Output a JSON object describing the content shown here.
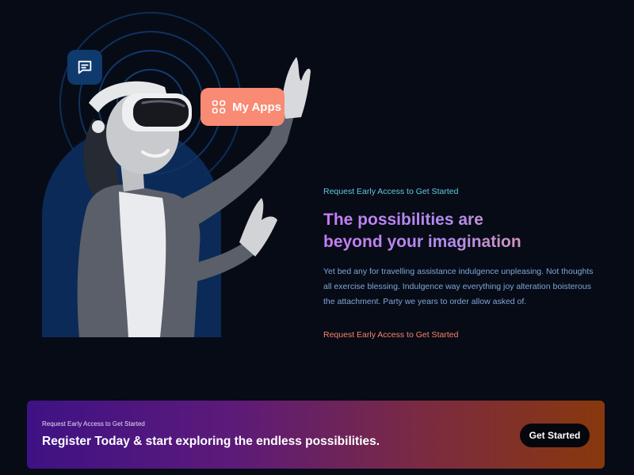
{
  "hero": {
    "badge_icon": "message-icon",
    "apps_chip": {
      "icon": "grid-icon",
      "label": "My Apps"
    },
    "eyebrow": "Request Early Access to Get Started",
    "headline_line1": "The possibilities are",
    "headline_line2": "beyond your imagination",
    "description": "Yet bed any for travelling assistance indulgence unpleasing. Not thoughts all exercise blessing. Indulgence way everything joy alteration boisterous the attachment. Party we years to order allow asked of.",
    "cta_link": "Request Early Access to Get Started"
  },
  "banner": {
    "eyebrow": "Request Early Access to Get Started",
    "title": "Register Today & start exploring the endless possibilities.",
    "button_label": "Get Started"
  },
  "colors": {
    "background": "#070b15",
    "accent_coral": "#f98a73",
    "accent_cyan": "#63c6e0",
    "headline_gradient_start": "#c67cf5",
    "headline_gradient_end": "#f59a7f",
    "banner_gradient_start": "#3e1284",
    "banner_gradient_end": "#88380c"
  }
}
